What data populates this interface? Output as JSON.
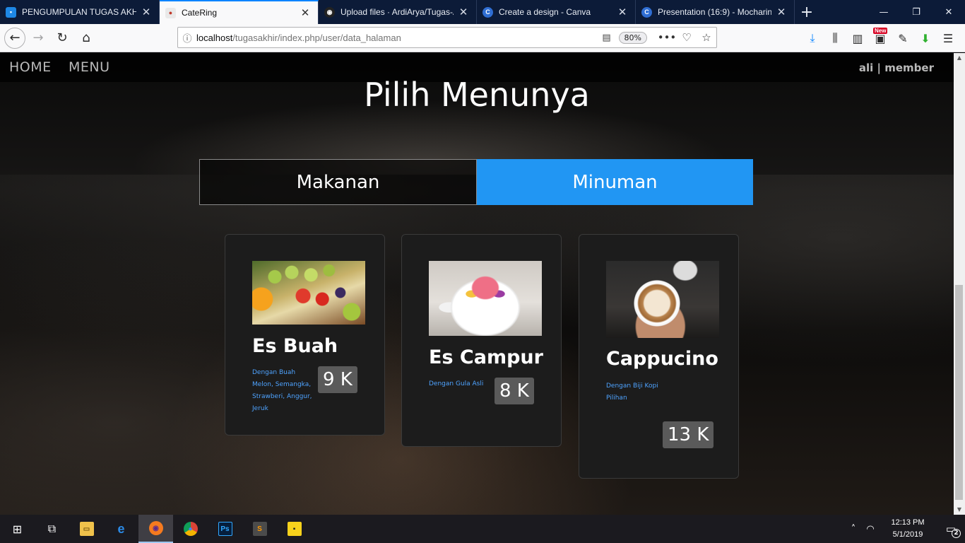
{
  "browser": {
    "tabs": [
      {
        "title": "PENGUMPULAN TUGAS AKHIR",
        "icon": "classroom-icon",
        "active": false
      },
      {
        "title": "CateRing",
        "icon": "catering-favicon-icon",
        "active": true
      },
      {
        "title": "Upload files · ArdiArya/Tugas-A",
        "icon": "github-icon",
        "active": false
      },
      {
        "title": "Create a design - Canva",
        "icon": "canva-icon",
        "active": false
      },
      {
        "title": "Presentation (16:9) - Mocharin",
        "icon": "canva-icon",
        "active": false
      }
    ],
    "url_host": "localhost",
    "url_path": "/tugasakhir/index.php/user/data_halaman",
    "zoom": "80%",
    "new_badge": "New"
  },
  "page": {
    "nav": {
      "home": "HOME",
      "menu": "MENU",
      "user": "ali | member"
    },
    "heading": "Pilih Menunya",
    "tabs": {
      "food": "Makanan",
      "drink": "Minuman"
    },
    "active_tab_color": "#2196f3",
    "items": [
      {
        "name": "Es Buah",
        "desc": "Dengan Buah Melon, Semangka, Strawberi, Anggur, Jeruk",
        "price": "9 K"
      },
      {
        "name": "Es Campur",
        "desc": "Dengan Gula Asli",
        "price": "8 K"
      },
      {
        "name": "Cappucino",
        "desc": "Dengan Biji Kopi Pilihan",
        "price": "13 K"
      }
    ]
  },
  "taskbar": {
    "time": "12:13 PM",
    "date": "5/1/2019",
    "notifications": "2",
    "apps": [
      "start-icon",
      "task-view-icon",
      "file-explorer-icon",
      "edge-icon",
      "firefox-icon",
      "chrome-icon",
      "photoshop-icon",
      "sublime-icon",
      "sticky-notes-icon"
    ]
  }
}
